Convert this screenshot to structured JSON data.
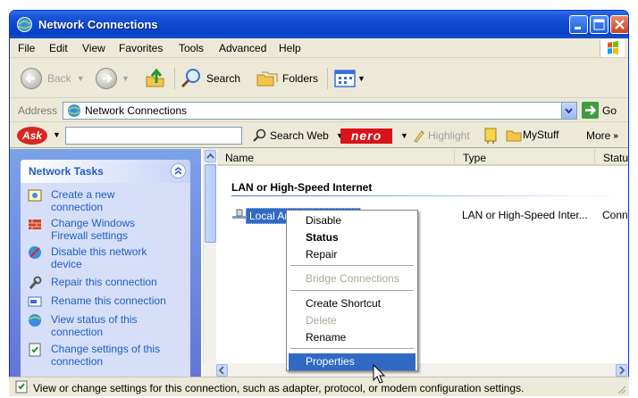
{
  "window": {
    "title": "Network Connections"
  },
  "menubar": {
    "items": [
      "File",
      "Edit",
      "View",
      "Favorites",
      "Tools",
      "Advanced",
      "Help"
    ]
  },
  "toolbar": {
    "back": "Back",
    "search": "Search",
    "folders": "Folders"
  },
  "address": {
    "label": "Address",
    "value": "Network Connections",
    "go": "Go"
  },
  "askbar": {
    "logo": "Ask",
    "search_web": "Search Web",
    "nero": "nero",
    "highlight": "Highlight",
    "mystuff": "MyStuff",
    "more": "More"
  },
  "taskpane": {
    "title": "Network Tasks",
    "tasks": [
      {
        "label": "Create a new connection",
        "icon": "new-connection-icon"
      },
      {
        "label": "Change Windows Firewall settings",
        "icon": "firewall-icon"
      },
      {
        "label": "Disable this network device",
        "icon": "disable-network-icon"
      },
      {
        "label": "Repair this connection",
        "icon": "repair-icon"
      },
      {
        "label": "Rename this connection",
        "icon": "rename-icon"
      },
      {
        "label": "View status of this connection",
        "icon": "status-icon"
      },
      {
        "label": "Change settings of this connection",
        "icon": "settings-icon"
      }
    ]
  },
  "listview": {
    "columns": [
      "Name",
      "Type",
      "Status"
    ],
    "group": "LAN or High-Speed Internet",
    "item": {
      "name": "Local Area Connection",
      "type": "LAN or High-Speed Inter...",
      "status": "Connec"
    }
  },
  "context_menu": {
    "items": [
      "Disable",
      "Status",
      "Repair",
      "Bridge Connections",
      "Create Shortcut",
      "Delete",
      "Rename",
      "Properties"
    ],
    "default_item": "Status",
    "disabled_items": [
      "Bridge Connections",
      "Delete"
    ],
    "highlighted_item": "Properties"
  },
  "statusbar": {
    "text": "View or change settings for this connection, such as adapter, protocol, or modem configuration settings."
  },
  "colors": {
    "title_blue": "#0a46cf",
    "selection": "#316ac5",
    "task_link": "#215dc6",
    "task_pane": "#6375d6"
  }
}
